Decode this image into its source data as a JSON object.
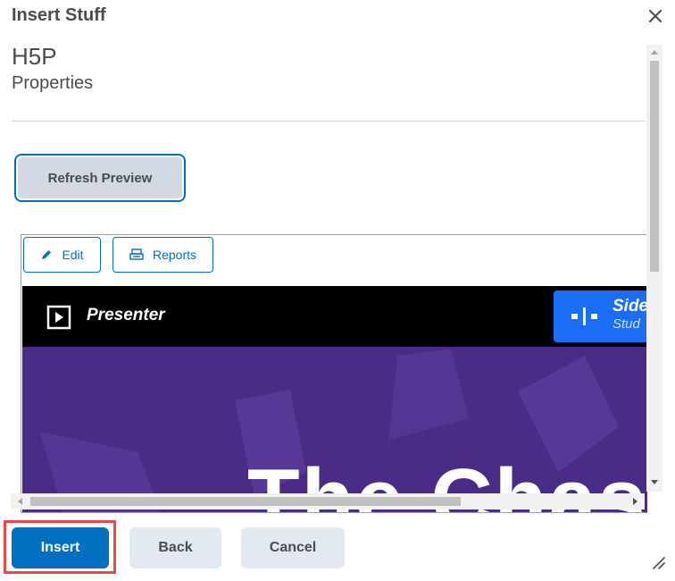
{
  "dialog": {
    "title": "Insert Stuff",
    "close_icon": "close-icon"
  },
  "content": {
    "heading": "H5P",
    "subheading": "Properties",
    "refresh_label": "Refresh Preview"
  },
  "preview": {
    "edit_label": "Edit",
    "edit_icon": "pencil-icon",
    "reports_label": "Reports",
    "reports_icon": "reports-icon",
    "presenter_label": "Presenter",
    "presenter_icon": "play-icon",
    "badge_title": "Side",
    "badge_subtitle": "Stud",
    "slide_title": "The Chase",
    "colors": {
      "accent": "#006fbf",
      "slide_bg": "#4a2c86",
      "badge_bg": "#1a6ef5",
      "bar_bg": "#000000"
    }
  },
  "footer": {
    "insert_label": "Insert",
    "back_label": "Back",
    "cancel_label": "Cancel",
    "highlight_color": "#e8474c"
  }
}
